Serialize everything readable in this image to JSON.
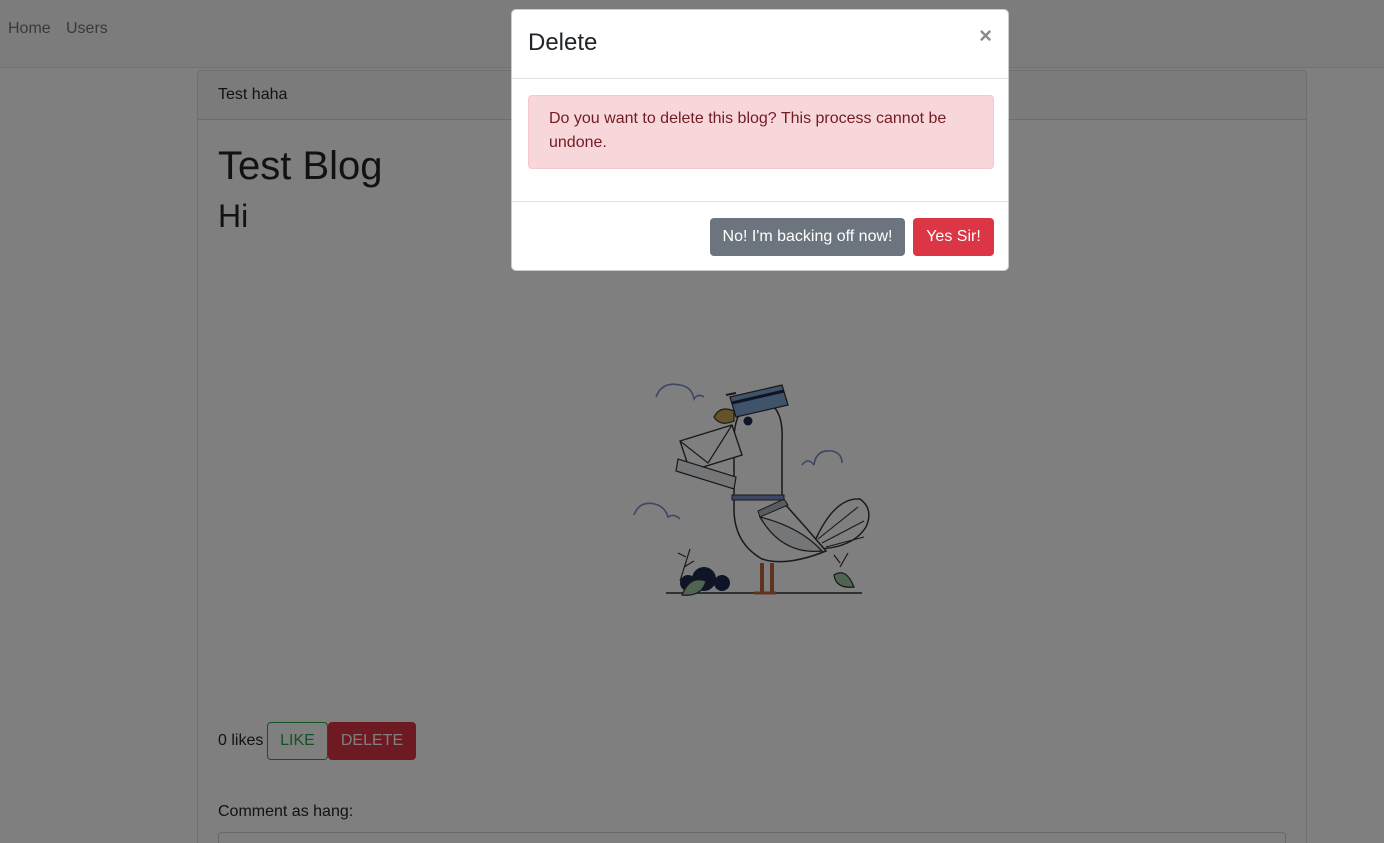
{
  "nav": {
    "home": "Home",
    "users": "Users"
  },
  "card": {
    "header": "Test haha",
    "title": "Test Blog",
    "body": "Hi",
    "illustration_icon": "pigeon-mail-illustration",
    "likes": "0 likes",
    "like_label": "LIKE",
    "delete_label": "DELETE",
    "comment_label": "Comment as hang:"
  },
  "modal": {
    "title": "Delete",
    "close_symbol": "×",
    "message": "Do you want to delete this blog? This process cannot be undone.",
    "cancel_label": "No! I'm backing off now!",
    "confirm_label": "Yes Sir!"
  },
  "colors": {
    "danger": "#dc3545",
    "success": "#28a745",
    "secondary": "#6c757d",
    "alert_bg": "#f8d7da",
    "alert_text": "#721c24"
  }
}
